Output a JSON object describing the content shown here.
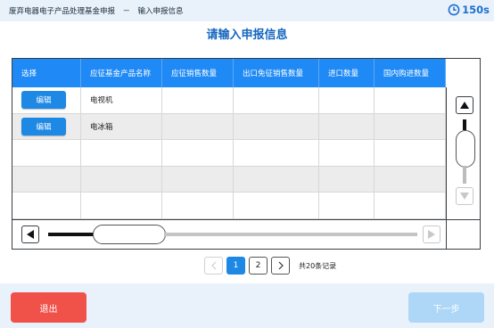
{
  "header": {
    "breadcrumb": "废弃电器电子产品处理基金申报　－　输入申报信息",
    "timer": "150s",
    "timer_icon": "clock-icon"
  },
  "page_title": "请输入申报信息",
  "table": {
    "columns": [
      "选择",
      "应征基金产品名称",
      "应征销售数量",
      "出口免征销售数量",
      "进口数量",
      "国内购进数量"
    ],
    "rows": [
      {
        "action": "编辑",
        "product": "电视机",
        "sales": "",
        "export": "",
        "import": "",
        "domestic": ""
      },
      {
        "action": "编辑",
        "product": "电冰箱",
        "sales": "",
        "export": "",
        "import": "",
        "domestic": ""
      },
      {
        "action": "",
        "product": "",
        "sales": "",
        "export": "",
        "import": "",
        "domestic": ""
      },
      {
        "action": "",
        "product": "",
        "sales": "",
        "export": "",
        "import": "",
        "domestic": ""
      },
      {
        "action": "",
        "product": "",
        "sales": "",
        "export": "",
        "import": "",
        "domestic": ""
      }
    ]
  },
  "pagination": {
    "pages": [
      "1",
      "2"
    ],
    "current": "1",
    "total": "共20条记录"
  },
  "footer": {
    "exit_label": "退出",
    "next_label": "下一步"
  },
  "colors": {
    "accent": "#1e88e5",
    "header_blue": "#1f8af5",
    "exit_red": "#f0524a",
    "next_disabled": "#aed7f7",
    "bar_bg": "#e9f2fb"
  }
}
